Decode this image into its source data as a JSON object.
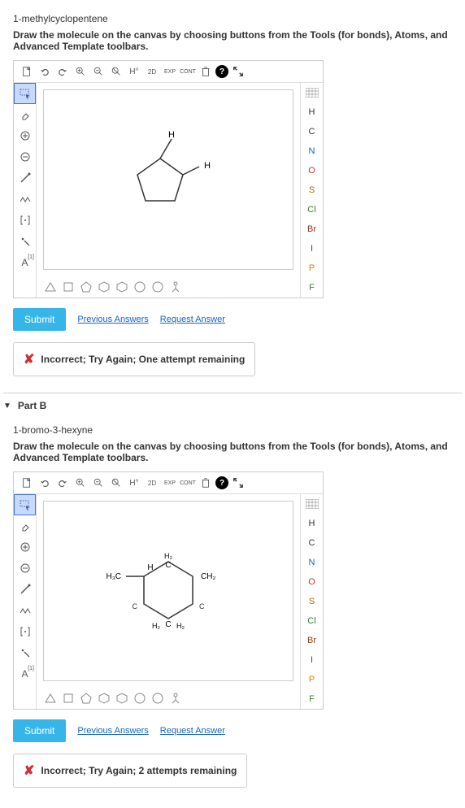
{
  "partA": {
    "title": "1-methylcyclopentene",
    "instruction": "Draw the molecule on the canvas by choosing buttons from the Tools (for bonds), Atoms, and Advanced Template toolbars.",
    "submit": "Submit",
    "prev": "Previous Answers",
    "req": "Request Answer",
    "feedback": "Incorrect; Try Again; One attempt remaining"
  },
  "partB": {
    "header": "Part B",
    "title": "1-bromo-3-hexyne",
    "instruction": "Draw the molecule on the canvas by choosing buttons from the Tools (for bonds), Atoms, and Advanced Template toolbars.",
    "submit": "Submit",
    "prev": "Previous Answers",
    "req": "Request Answer",
    "feedback": "Incorrect; Try Again; 2 attempts remaining"
  },
  "toolbar": {
    "h_btn": "H°",
    "d2": "2D",
    "exp": "EXP",
    "cont": "CONT"
  },
  "atoms": [
    "H",
    "C",
    "N",
    "O",
    "S",
    "Cl",
    "Br",
    "I",
    "P",
    "F"
  ],
  "left": {
    "a_label": "A",
    "a_sup": "[1]"
  },
  "mol1": {
    "h1": "H",
    "h2": "H"
  },
  "mol2": {
    "h3c": "H₃C",
    "h": "H",
    "h2a": "H₂",
    "c": "C",
    "ch2": "CH₂",
    "h2b": "H₂",
    "h2c": "H₂"
  }
}
